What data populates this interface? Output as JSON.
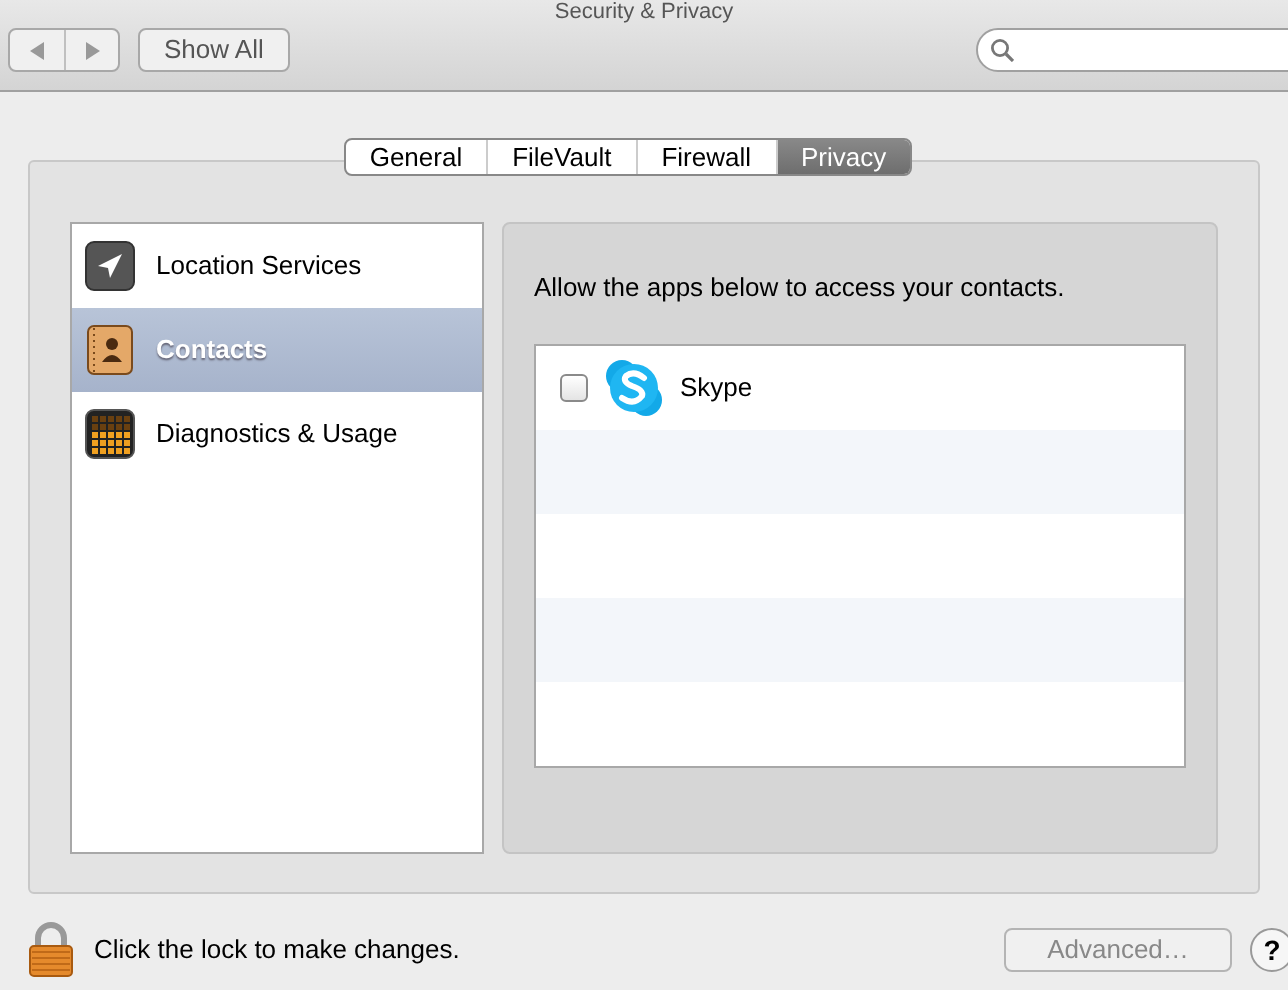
{
  "window": {
    "title": "Security & Privacy"
  },
  "toolbar": {
    "show_all": "Show All",
    "back_disabled": true,
    "forward_disabled": true
  },
  "tabs": [
    {
      "label": "General",
      "selected": false
    },
    {
      "label": "FileVault",
      "selected": false
    },
    {
      "label": "Firewall",
      "selected": false
    },
    {
      "label": "Privacy",
      "selected": true
    }
  ],
  "sidebar": {
    "items": [
      {
        "label": "Location Services",
        "kind": "location",
        "selected": false
      },
      {
        "label": "Contacts",
        "kind": "contacts",
        "selected": true
      },
      {
        "label": "Diagnostics & Usage",
        "kind": "diagnostics",
        "selected": false
      }
    ]
  },
  "detail": {
    "description": "Allow the apps below to access your contacts.",
    "apps": [
      {
        "name": "Skype",
        "checked": false
      }
    ]
  },
  "footer": {
    "lock_text": "Click the lock to make changes.",
    "advanced": {
      "label": "Advanced…",
      "disabled": true
    },
    "help": "?"
  }
}
